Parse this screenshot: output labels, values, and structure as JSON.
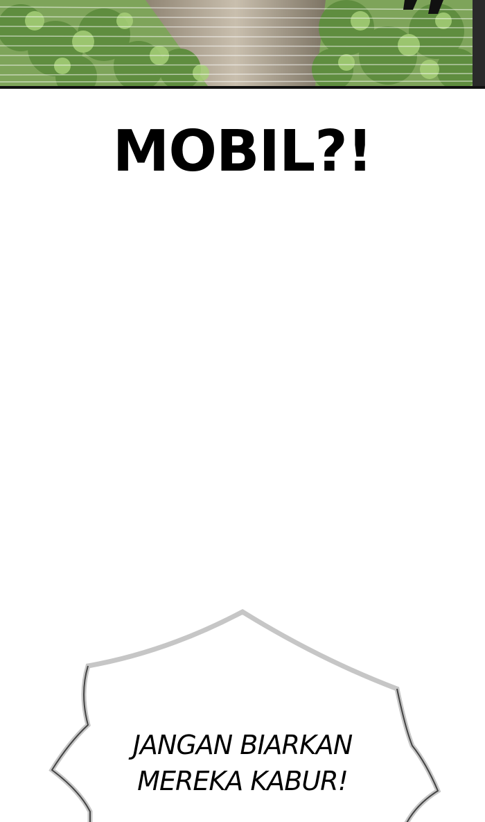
{
  "top_panel": {
    "colors": {
      "foliage": "#6e9a4c",
      "foliage_light": "#a8d07a",
      "road": "#b9ad9c",
      "border": "#111111"
    }
  },
  "exclamation": {
    "text": "MOBIL?!"
  },
  "speech_bubble": {
    "lines": [
      "JANGAN BIARKAN",
      "MEREKA KABUR!"
    ],
    "colors": {
      "outline": "#c8c8c8",
      "outline_dark": "#555555"
    }
  }
}
